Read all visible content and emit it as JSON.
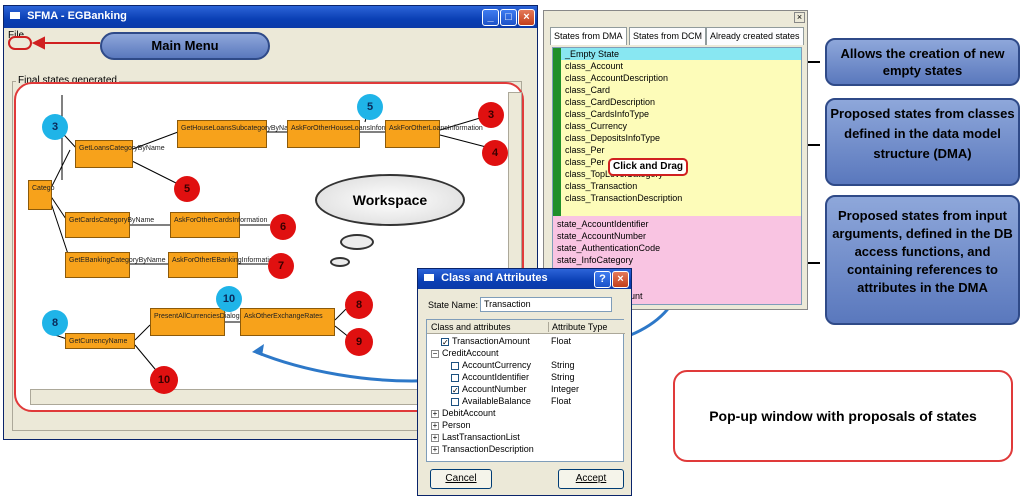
{
  "main_window": {
    "title": "SFMA - EGBanking",
    "menu": {
      "file": "File"
    },
    "group_label": "Final states generated"
  },
  "annotations": {
    "main_menu": "Main Menu",
    "workspace": "Workspace",
    "click_drag": "Click and Drag",
    "allows_creation": "Allows the creation of new empty states",
    "proposed_dma": "Proposed states from classes defined in the data model structure (DMA)",
    "proposed_input": "Proposed states from input arguments, defined in the DB access functions, and containing references to attributes in the DMA",
    "popup": "Pop-up window with proposals of states"
  },
  "graph": {
    "nodes": [
      {
        "label": "Catego"
      },
      {
        "label": "GetLoansCategoryByName"
      },
      {
        "label": "GetHouseLoansSubcategoryByName"
      },
      {
        "label": "AskForOtherHouseLoansInformation"
      },
      {
        "label": "AskForOtherLoansInformation"
      },
      {
        "label": "GetCardsCategoryByName"
      },
      {
        "label": "AskForOtherCardsInformation"
      },
      {
        "label": "GetEBankingCategoryByName"
      },
      {
        "label": "AskForOtherEBankingInformation"
      },
      {
        "label": "GetCurrencyName"
      },
      {
        "label": "PresentAllCurrenciesDialog"
      },
      {
        "label": "AskOtherExchangeRates"
      }
    ],
    "circles": [
      {
        "label": "3",
        "color": "blue"
      },
      {
        "label": "5",
        "color": "blue"
      },
      {
        "label": "3",
        "color": "red"
      },
      {
        "label": "4",
        "color": "red"
      },
      {
        "label": "5",
        "color": "red"
      },
      {
        "label": "6",
        "color": "red"
      },
      {
        "label": "7",
        "color": "red"
      },
      {
        "label": "8",
        "color": "blue"
      },
      {
        "label": "10",
        "color": "blue"
      },
      {
        "label": "8",
        "color": "red"
      },
      {
        "label": "9",
        "color": "red"
      },
      {
        "label": "10",
        "color": "red"
      }
    ]
  },
  "states_panel": {
    "tabs": [
      "States from DMA",
      "States from DCM",
      "Already created states"
    ],
    "dma_states": [
      "_Empty State",
      "class_Account",
      "class_AccountDescription",
      "class_Card",
      "class_CardDescription",
      "class_CardsInfoType",
      "class_Currency",
      "class_DepositsInfoType",
      "class_Per",
      "class_Per",
      "class_TopLevelCategory",
      "class_Transaction",
      "class_TransactionDescription"
    ],
    "input_states": [
      "state_AccountIdentifier",
      "state_AccountNumber",
      "state_AuthenticationCode",
      "state_InfoCategory",
      "y",
      "ount"
    ]
  },
  "dialog": {
    "title": "Class and Attributes",
    "state_name_label": "State Name:",
    "state_name_value": "Transaction",
    "col_class": "Class and attributes",
    "col_type": "Attribute Type",
    "rows": [
      {
        "label": "TransactionAmount",
        "type": "Float",
        "checked": true,
        "indent": 1,
        "kind": "check"
      },
      {
        "label": "CreditAccount",
        "type": "",
        "checked": false,
        "indent": 0,
        "kind": "node"
      },
      {
        "label": "AccountCurrency",
        "type": "String",
        "checked": false,
        "indent": 2,
        "kind": "check"
      },
      {
        "label": "AccountIdentifier",
        "type": "String",
        "checked": false,
        "indent": 2,
        "kind": "check"
      },
      {
        "label": "AccountNumber",
        "type": "Integer",
        "checked": true,
        "indent": 2,
        "kind": "check"
      },
      {
        "label": "AvailableBalance",
        "type": "Float",
        "checked": false,
        "indent": 2,
        "kind": "check"
      },
      {
        "label": "DebitAccount",
        "type": "",
        "checked": false,
        "indent": 0,
        "kind": "node"
      },
      {
        "label": "Person",
        "type": "",
        "checked": false,
        "indent": 0,
        "kind": "node"
      },
      {
        "label": "LastTransactionList",
        "type": "",
        "checked": false,
        "indent": 0,
        "kind": "node"
      },
      {
        "label": "TransactionDescription",
        "type": "",
        "checked": false,
        "indent": 0,
        "kind": "node"
      }
    ],
    "cancel": "Cancel",
    "accept": "Accept"
  }
}
